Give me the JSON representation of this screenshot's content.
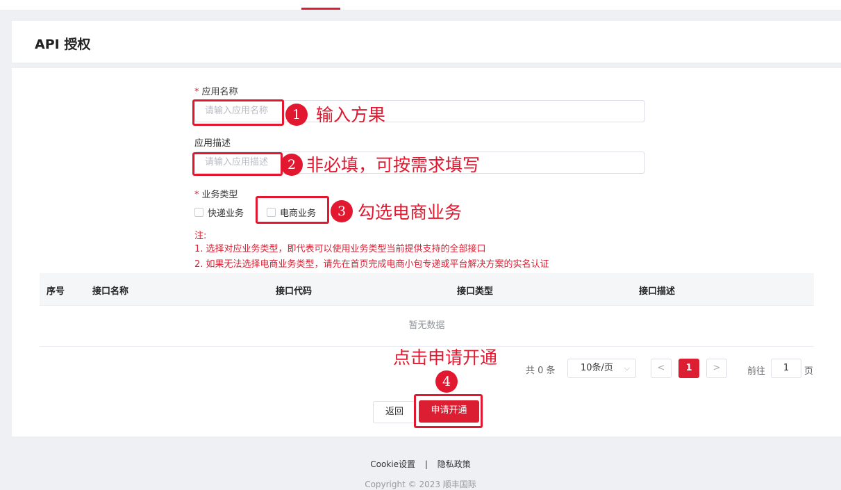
{
  "title": "API 授权",
  "form": {
    "app_name_label": "应用名称",
    "app_name_placeholder": "请输入应用名称",
    "app_desc_label": "应用描述",
    "app_desc_placeholder": "请输入应用描述",
    "biz_type_label": "业务类型",
    "required_mark": "*",
    "options": [
      {
        "label": "快递业务",
        "checked": false
      },
      {
        "label": "电商业务",
        "checked": false
      }
    ],
    "note_title": "注:",
    "notes": [
      "1. 选择对应业务类型，即代表可以使用业务类型当前提供支持的全部接口",
      "2. 如果无法选择电商业务类型，请先在首页完成电商小包专递或平台解决方案的实名认证"
    ]
  },
  "table": {
    "columns": [
      "序号",
      "接口名称",
      "接口代码",
      "接口类型",
      "接口描述"
    ],
    "empty_text": "暂无数据"
  },
  "pagination": {
    "total": "共 0 条",
    "page_size": "10条/页",
    "prev": "<",
    "current": "1",
    "next": ">",
    "goto_label": "前往",
    "goto_value": "1",
    "page_unit": "页"
  },
  "buttons": {
    "back": "返回",
    "apply": "申请开通"
  },
  "annotations": {
    "step1_num": "1",
    "step1_text": "输入方果",
    "step2_num": "2",
    "step2_text": "非必填，可按需求填写",
    "step3_num": "3",
    "step3_text": "勾选电商业务",
    "step4_num": "4",
    "step4_text": "点击申请开通"
  },
  "footer": {
    "cookie": "Cookie设置",
    "separator": "|",
    "privacy": "隐私政策",
    "copyright": "Copyright © 2023 顺丰国际"
  },
  "colors": {
    "accent": "#dc1e32",
    "annotation": "#e1182f"
  }
}
